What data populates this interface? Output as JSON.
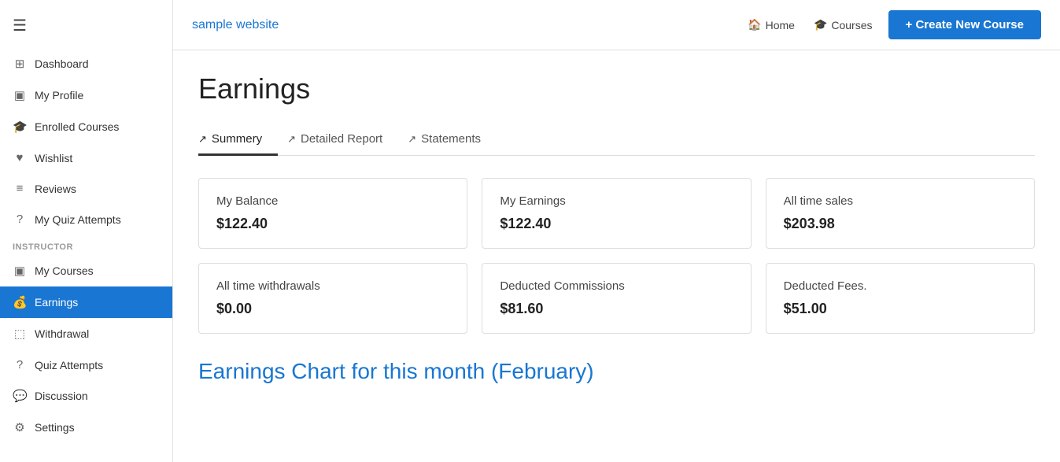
{
  "sidebar": {
    "hamburger": "☰",
    "items": [
      {
        "id": "dashboard",
        "label": "Dashboard",
        "icon": "⊞"
      },
      {
        "id": "my-profile",
        "label": "My Profile",
        "icon": "▣"
      },
      {
        "id": "enrolled-courses",
        "label": "Enrolled Courses",
        "icon": "🎓"
      },
      {
        "id": "wishlist",
        "label": "Wishlist",
        "icon": "♥"
      },
      {
        "id": "reviews",
        "label": "Reviews",
        "icon": "≡"
      },
      {
        "id": "my-quiz-attempts",
        "label": "My Quiz Attempts",
        "icon": "?"
      }
    ],
    "instructor_label": "INSTRUCTOR",
    "instructor_items": [
      {
        "id": "my-courses",
        "label": "My Courses",
        "icon": "▣"
      },
      {
        "id": "earnings",
        "label": "Earnings",
        "icon": "💰",
        "active": true
      },
      {
        "id": "withdrawal",
        "label": "Withdrawal",
        "icon": "⬚"
      },
      {
        "id": "quiz-attempts",
        "label": "Quiz Attempts",
        "icon": "?"
      },
      {
        "id": "discussion",
        "label": "Discussion",
        "icon": "💬"
      },
      {
        "id": "settings",
        "label": "Settings",
        "icon": "⚙"
      }
    ]
  },
  "topnav": {
    "brand": "sample website",
    "links": [
      {
        "id": "home",
        "label": "Home",
        "icon": "🏠"
      },
      {
        "id": "courses",
        "label": "Courses",
        "icon": "🎓"
      }
    ],
    "create_button": "+ Create New Course"
  },
  "page": {
    "title": "Earnings",
    "tabs": [
      {
        "id": "summery",
        "label": "Summery",
        "active": true
      },
      {
        "id": "detailed-report",
        "label": "Detailed Report",
        "active": false
      },
      {
        "id": "statements",
        "label": "Statements",
        "active": false
      }
    ],
    "cards": [
      {
        "id": "my-balance",
        "label": "My Balance",
        "value": "$122.40"
      },
      {
        "id": "my-earnings",
        "label": "My Earnings",
        "value": "$122.40"
      },
      {
        "id": "all-time-sales",
        "label": "All time sales",
        "value": "$203.98"
      },
      {
        "id": "all-time-withdrawals",
        "label": "All time withdrawals",
        "value": "$0.00"
      },
      {
        "id": "deducted-commissions",
        "label": "Deducted Commissions",
        "value": "$81.60"
      },
      {
        "id": "deducted-fees",
        "label": "Deducted Fees.",
        "value": "$51.00"
      }
    ],
    "chart_title": "Earnings Chart for this month (February)"
  }
}
